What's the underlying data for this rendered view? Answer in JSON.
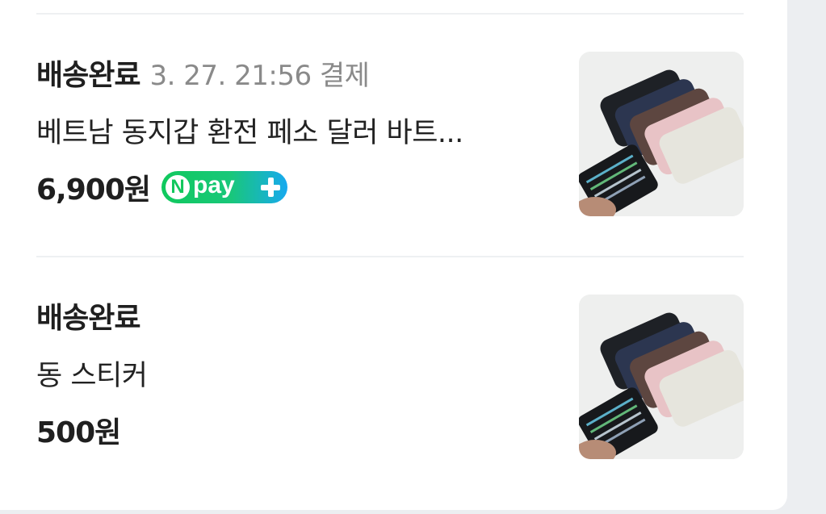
{
  "orders": [
    {
      "status": "배송완료",
      "date": "3. 27. 21:56 결제",
      "title": "베트남 동지갑 환전 페소 달러 바트...",
      "price": "6,900원",
      "badge": {
        "brand_letter": "N",
        "text": "pay"
      },
      "thumbnail_icon": "wallet-product-photo"
    },
    {
      "status": "배송완료",
      "date": "",
      "title": "동 스티커",
      "price": "500원",
      "thumbnail_icon": "wallet-product-photo"
    }
  ],
  "colors": {
    "status_text": "#1f1f1f",
    "date_text": "#8a8a8a",
    "npay_green": "#10c95d",
    "npay_blue": "#17a9f0",
    "page_background": "#eceef1",
    "card_background": "#ffffff"
  }
}
